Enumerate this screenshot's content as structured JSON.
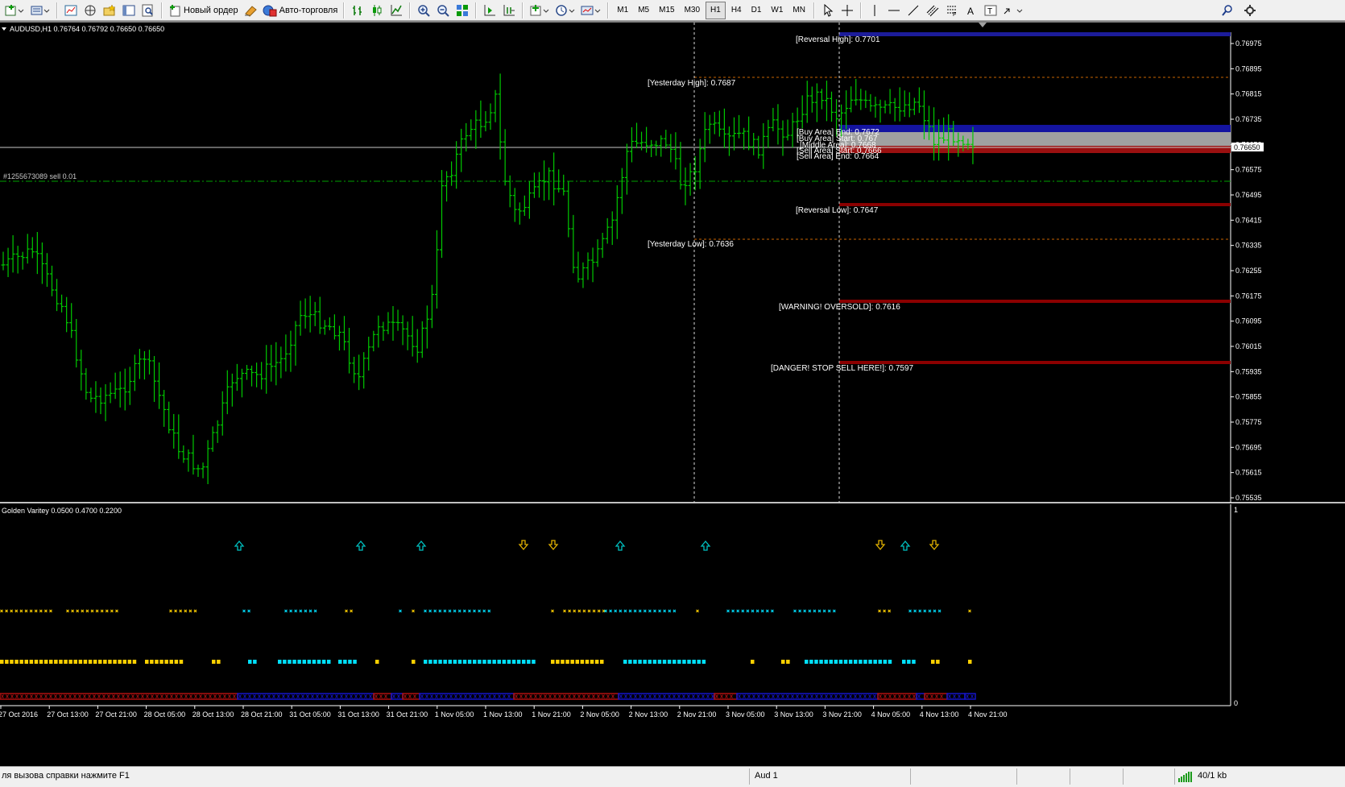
{
  "toolbar": {
    "new_order_label": "Новый ордер",
    "autotrading_label": "Авто-торговля",
    "timeframes": [
      "M1",
      "M5",
      "M15",
      "M30",
      "H1",
      "H4",
      "D1",
      "W1",
      "MN"
    ],
    "active_timeframe": "H1"
  },
  "chart": {
    "header": "AUDUSD,H1  0.76764 0.76792 0.76650 0.76650",
    "order_label": "#1255673089 sell 0.01",
    "price_tag": "0.76650",
    "price_axis": [
      "0.76975",
      "0.76895",
      "0.76815",
      "0.76735",
      "0.76650",
      "0.76575",
      "0.76495",
      "0.76415",
      "0.76335",
      "0.76255",
      "0.76175",
      "0.76095",
      "0.76015",
      "0.75935",
      "0.75855",
      "0.75775",
      "0.75695",
      "0.75615",
      "0.75535"
    ],
    "levels": {
      "reversal_high": "[Reversal High]: 0.7701",
      "yesterday_high": "[Yesterday High]: 0.7687",
      "buy_area_end": "[Buy Area] End: 0.7672",
      "buy_area_start": "[Buy Area] Start: 0.767",
      "middle_area": "[Middle Area]: 0.7668",
      "sell_area_start": "[Sell Area] Start: 0.7666",
      "sell_area_end": "[Sell Area] End: 0.7664",
      "reversal_low": "[Reversal Low]: 0.7647",
      "yesterday_low": "[Yesterday Low]: 0.7636",
      "warning": "[WARNING! OVERSOLD]: 0.7616",
      "danger": "[DANGER! STOP SELL HERE!]: 0.7597"
    }
  },
  "indicator": {
    "header": "Golden Varitey 0.0500 0.4700 0.2200",
    "axis_top": "1",
    "axis_bottom": "0"
  },
  "time_axis": [
    "27 Oct 2016",
    "27 Oct 13:00",
    "27 Oct 21:00",
    "28 Oct 05:00",
    "28 Oct 13:00",
    "28 Oct 21:00",
    "31 Oct 05:00",
    "31 Oct 13:00",
    "31 Oct 21:00",
    "1 Nov 05:00",
    "1 Nov 13:00",
    "1 Nov 21:00",
    "2 Nov 05:00",
    "2 Nov 13:00",
    "2 Nov 21:00",
    "3 Nov 05:00",
    "3 Nov 13:00",
    "3 Nov 21:00",
    "4 Nov 05:00",
    "4 Nov 13:00",
    "4 Nov 21:00"
  ],
  "status": {
    "help": "ля вызова справки нажмите F1",
    "profile": "Aud 1",
    "traffic": "40/1 kb"
  },
  "colors": {
    "bars": "#00c800",
    "buy_area": "#1414a0",
    "middle_area": "#a0a0a0",
    "sell_area": "#9a1010",
    "level_line": "#8b0000",
    "reversal_high_line": "#1c1c9a",
    "dashed": "#c86400",
    "order_line": "#00a000",
    "arrow_up": "#00c0c0",
    "arrow_down": "#e0b000",
    "dot_yellow": "#ffd000",
    "dot_cyan": "#00e0ff",
    "strip_red": "#b01010",
    "strip_blue": "#1414c8"
  }
}
